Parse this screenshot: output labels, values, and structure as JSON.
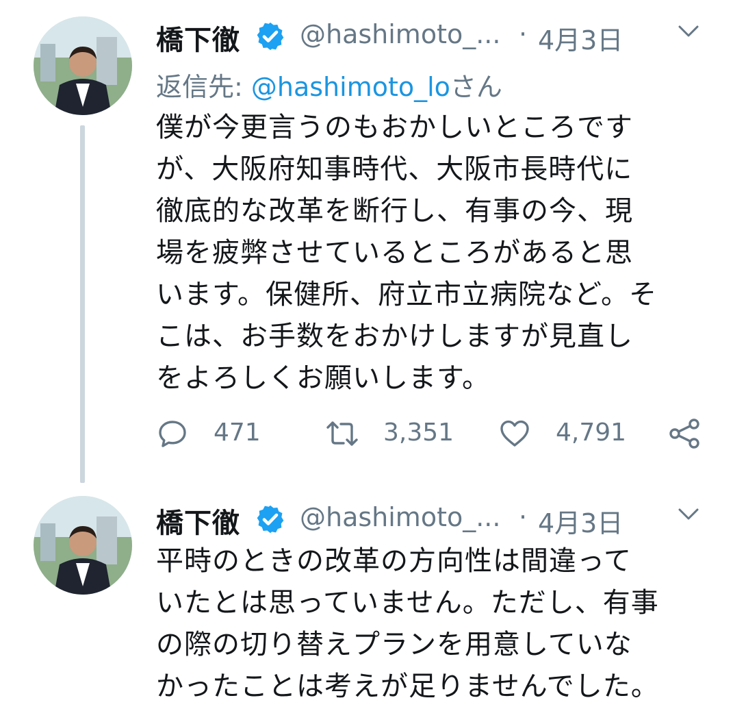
{
  "tweets": [
    {
      "author_name": "橋下徹",
      "handle": "@hashimoto_...",
      "separator": "·",
      "date": "4月3日",
      "reply_prefix": "返信先: ",
      "reply_mention": "@hashimoto_lo",
      "reply_suffix": "さん",
      "body_lines": [
        "僕が今更言うのもおかしいところです",
        "が、大阪府知事時代、大阪市長時代に",
        "徹底的な改革を断行し、有事の今、現",
        "場を疲弊させているところがあると思",
        "います。保健所、府立市立病院など。そ",
        "こは、お手数をおかけしますが見直し",
        "をよろしくお願いします。"
      ],
      "reply_count": "471",
      "retweet_count": "3,351",
      "like_count": "4,791"
    },
    {
      "author_name": "橋下徹",
      "handle": "@hashimoto_...",
      "separator": "·",
      "date": "4月3日",
      "body_lines": [
        "平時のときの改革の方向性は間違って",
        "いたとは思っていません。ただし、有事",
        "の際の切り替えプランを用意していな",
        "かったことは考えが足りませんでした。"
      ]
    }
  ],
  "icons": {
    "verified": "verified-badge-icon",
    "menu": "chevron-down-icon",
    "reply": "reply-icon",
    "retweet": "retweet-icon",
    "like": "heart-icon",
    "share": "share-icon"
  },
  "colors": {
    "text": "#14171a",
    "secondary": "#657786",
    "link": "#1b95e0",
    "verified": "#1da1f2",
    "thread_line": "#ccd6dd"
  }
}
